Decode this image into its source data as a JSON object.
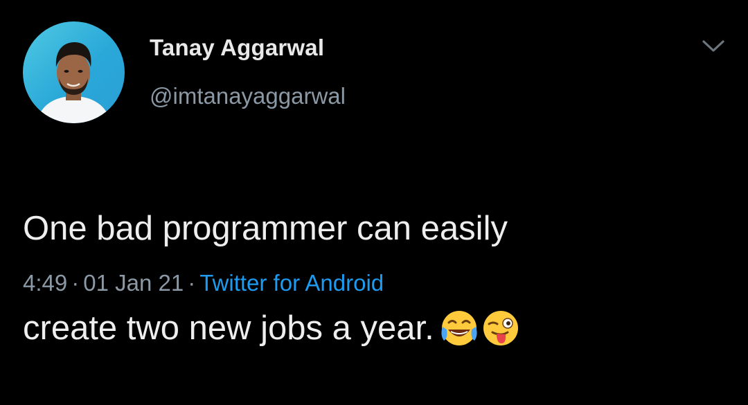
{
  "tweet": {
    "author": {
      "display_name": "Tanay Aggarwal",
      "handle": "@imtanayaggarwal"
    },
    "text_line_1": "One bad programmer can easily",
    "text_line_2": "create two new jobs a year.",
    "emojis": [
      "face-with-tears-of-joy-icon",
      "winking-face-with-tongue-icon"
    ],
    "time": "4:49",
    "separator": "·",
    "date": "01 Jan 21",
    "source": "Twitter for Android"
  },
  "colors": {
    "background": "#000000",
    "primary_text": "#e7e9ea",
    "secondary_text": "#8b98a5",
    "link": "#1d9bf0",
    "avatar_bg": "#2aa8d8"
  },
  "icons": {
    "more_menu": "chevron-down-icon"
  }
}
